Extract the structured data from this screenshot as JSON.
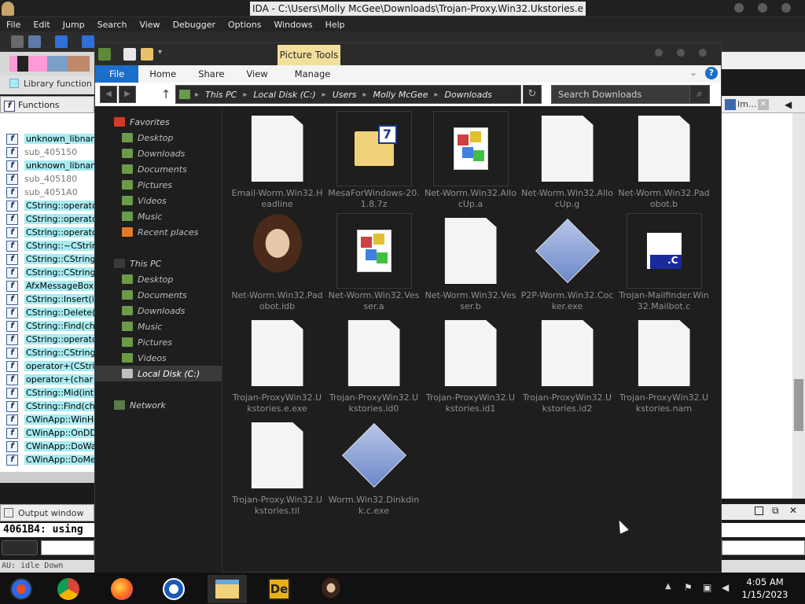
{
  "ida": {
    "title": "IDA - C:\\Users\\Molly McGee\\Downloads\\Trojan-Proxy.Win32.Ukstories.e",
    "menu": [
      "File",
      "Edit",
      "Jump",
      "Search",
      "View",
      "Debugger",
      "Options",
      "Windows",
      "Help"
    ],
    "legend": "Library function",
    "functions_window_title": "Functions window",
    "functions": [
      {
        "name": "unknown_libname",
        "kind": "lib"
      },
      {
        "name": "sub_405150",
        "kind": "gray"
      },
      {
        "name": "unknown_libname",
        "kind": "lib"
      },
      {
        "name": "sub_405180",
        "kind": "gray"
      },
      {
        "name": "sub_4051A0",
        "kind": "gray"
      },
      {
        "name": "CString::operator",
        "kind": "lib"
      },
      {
        "name": "CString::operator",
        "kind": "lib"
      },
      {
        "name": "CString::operator",
        "kind": "lib"
      },
      {
        "name": "CString::~CString",
        "kind": "lib"
      },
      {
        "name": "CString::CString(C",
        "kind": "lib"
      },
      {
        "name": "CString::CString(c",
        "kind": "lib"
      },
      {
        "name": "AfxMessageBox(c",
        "kind": "lib"
      },
      {
        "name": "CString::Insert(in",
        "kind": "lib"
      },
      {
        "name": "CString::Delete(i",
        "kind": "lib"
      },
      {
        "name": "CString::Find(cha",
        "kind": "lib"
      },
      {
        "name": "CString::operator",
        "kind": "lib"
      },
      {
        "name": "CString::CString(v",
        "kind": "lib"
      },
      {
        "name": "operator+(CStrin",
        "kind": "lib"
      },
      {
        "name": "operator+(char c",
        "kind": "lib"
      },
      {
        "name": "CString::Mid(int)",
        "kind": "lib"
      },
      {
        "name": "CString::Find(cha",
        "kind": "lib"
      },
      {
        "name": "CWinApp::WinHe",
        "kind": "lib"
      },
      {
        "name": "CWinApp::OnDDE",
        "kind": "lib"
      },
      {
        "name": "CWinApp::DoWa",
        "kind": "lib"
      },
      {
        "name": "CWinApp::DoMes",
        "kind": "lib"
      }
    ],
    "output_window_title": "Output window",
    "output_line": "4061B4: using",
    "status_au": "AU:",
    "status_state": "idle",
    "status_down": "Down",
    "right_tab_label": "Im..."
  },
  "explorer": {
    "picture_tools": "Picture Tools",
    "ribbon_tabs": [
      "File",
      "Home",
      "Share",
      "View",
      "Manage"
    ],
    "address": [
      "This PC",
      "Local Disk (C:)",
      "Users",
      "Molly McGee",
      "Downloads"
    ],
    "search_placeholder": "Search Downloads",
    "nav": {
      "favorites_label": "Favorites",
      "favorites": [
        "Desktop",
        "Downloads",
        "Documents",
        "Pictures",
        "Videos",
        "Music",
        "Recent places"
      ],
      "this_pc_label": "This PC",
      "this_pc": [
        "Desktop",
        "Documents",
        "Downloads",
        "Music",
        "Pictures",
        "Videos",
        "Local Disk (C:)"
      ],
      "network_label": "Network"
    },
    "files": [
      {
        "name": "Email-Worm.Win32.Headline",
        "icon": "blank-file-icon"
      },
      {
        "name": "MesaForWindows-20.1.8.7z",
        "icon": "7z-archive-icon"
      },
      {
        "name": "Net-Worm.Win32.AllocUp.a",
        "icon": "library-file-icon"
      },
      {
        "name": "Net-Worm.Win32.AllocUp.g",
        "icon": "blank-file-icon"
      },
      {
        "name": "Net-Worm.Win32.Padobot.b",
        "icon": "blank-file-icon"
      },
      {
        "name": "Net-Worm.Win32.Padobot.idb",
        "icon": "portrait-thumbnail"
      },
      {
        "name": "Net-Worm.Win32.Vesser.a",
        "icon": "library-file-icon"
      },
      {
        "name": "Net-Worm.Win32.Vesser.b",
        "icon": "blank-file-icon"
      },
      {
        "name": "P2P-Worm.Win32.Cocker.exe",
        "icon": "executable-icon"
      },
      {
        "name": "Trojan-Mailfinder.Win32.Mailbot.c",
        "icon": "c-source-icon"
      },
      {
        "name": "Trojan-ProxyWin32.Ukstories.e.exe",
        "icon": "blank-file-icon"
      },
      {
        "name": "Trojan-ProxyWin32.Ukstories.id0",
        "icon": "blank-file-icon"
      },
      {
        "name": "Trojan-ProxyWin32.Ukstories.id1",
        "icon": "blank-file-icon"
      },
      {
        "name": "Trojan-ProxyWin32.Ukstories.id2",
        "icon": "blank-file-icon"
      },
      {
        "name": "Trojan-ProxyWin32.Ukstories.nam",
        "icon": "blank-file-icon"
      },
      {
        "name": "Trojan-Proxy.Win32.Ukstories.til",
        "icon": "blank-file-icon"
      },
      {
        "name": "Worm.Win32.Dinkdink.c.exe",
        "icon": "executable-icon"
      }
    ]
  },
  "taskbar": {
    "apps": [
      "ida-app-icon",
      "chrome-icon",
      "firefox-icon",
      "obama-campaign-icon",
      "file-explorer-icon",
      "dreamweaver-icon",
      "portrait-app-icon"
    ],
    "time": "4:05 AM",
    "date": "1/15/2023"
  }
}
